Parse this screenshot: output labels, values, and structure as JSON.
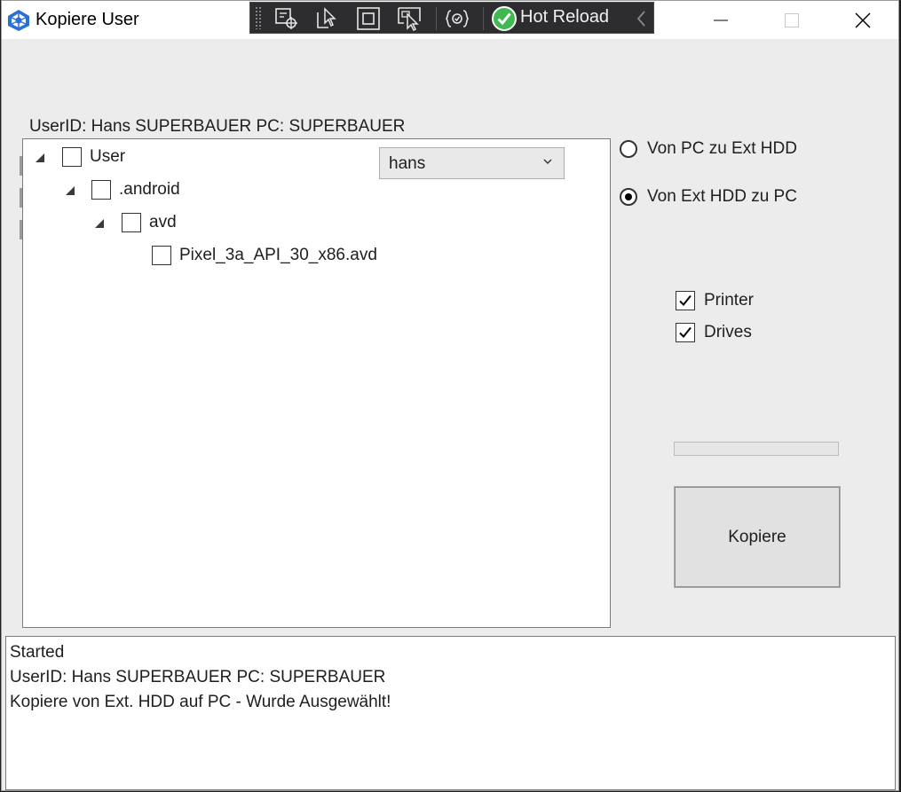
{
  "window": {
    "title": "Kopiere User"
  },
  "toolbar": {
    "hot_reload_label": "Hot Reload"
  },
  "user_info": "UserID: Hans  SUPERBAUER  PC: SUPERBAUER",
  "tree": {
    "nodes": [
      {
        "label": "User",
        "checked": false,
        "expanded": true
      },
      {
        "label": ".android",
        "checked": false,
        "expanded": true
      },
      {
        "label": "avd",
        "checked": false,
        "expanded": true
      },
      {
        "label": "Pixel_3a_API_30_x86.avd",
        "checked": false
      }
    ]
  },
  "user_select": {
    "value": "hans"
  },
  "direction": {
    "options": [
      {
        "label": "Von PC zu Ext HDD",
        "selected": false
      },
      {
        "label": "Von Ext HDD zu PC",
        "selected": true
      }
    ]
  },
  "options": {
    "printer": {
      "label": "Printer",
      "checked": true
    },
    "drives": {
      "label": "Drives",
      "checked": true
    }
  },
  "progress": {
    "value": 0
  },
  "actions": {
    "copy_label": "Kopiere"
  },
  "log": {
    "lines": [
      "Started",
      "UserID: Hans  SUPERBAUER  PC: SUPERBAUER",
      "Kopiere von Ext. HDD auf PC - Wurde Ausgewählt!"
    ]
  },
  "colors": {
    "window_bg": "#ececec",
    "toolbar_bg": "#2d2d30",
    "hot_reload_green": "#3fb950",
    "progress_fill": "#06b025"
  }
}
